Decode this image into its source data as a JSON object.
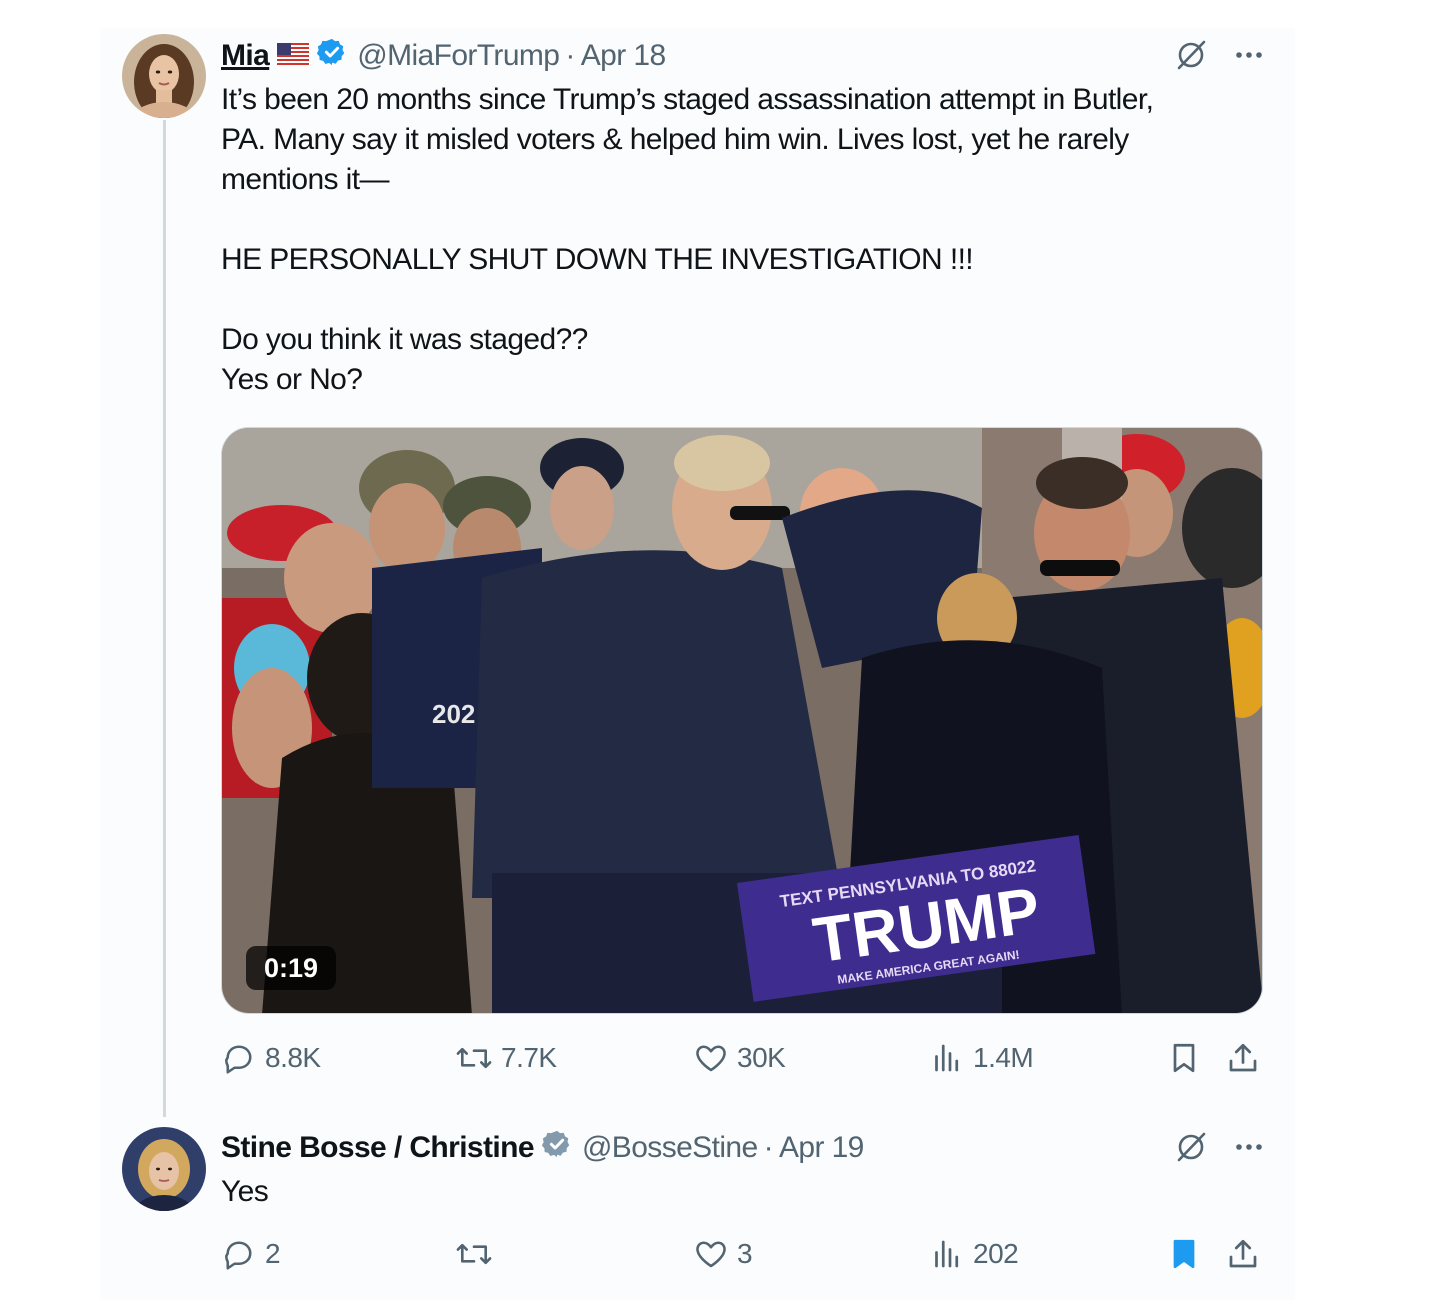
{
  "tweet": {
    "author_name": "Mia",
    "author_handle": "@MiaForTrump",
    "separator": "·",
    "date": "Apr 18",
    "text_lines": [
      "It’s been 20 months since Trump’s staged assassination attempt in Butler,",
      "PA. Many say it misled voters & helped him win. Lives lost, yet he rarely",
      "mentions it—",
      "",
      "HE PERSONALLY SHUT DOWN THE INVESTIGATION !!!",
      "",
      "Do you think it was staged??",
      "Yes or No?"
    ],
    "video": {
      "duration": "0:19",
      "sign_top": "TEXT PENNSYLVANIA TO 88022",
      "sign_main": "TRUMP",
      "sign_bottom": "MAKE AMERICA GREAT AGAIN!",
      "shirt_text": "202"
    },
    "stats": {
      "replies": "8.8K",
      "reposts": "7.7K",
      "likes": "30K",
      "views": "1.4M"
    }
  },
  "reply": {
    "author_name": "Stine Bosse / Christine",
    "author_handle": "@BosseStine",
    "separator": "·",
    "date": "Apr 19",
    "text": "Yes",
    "stats": {
      "replies": "2",
      "reposts": "",
      "likes": "3",
      "views": "202"
    },
    "bookmarked": true
  },
  "colors": {
    "accent": "#1d9bf0",
    "verified_blue": "#1d9bf0",
    "verified_gray": "#829aab",
    "muted": "#536471",
    "text": "#0f1419",
    "thread_line": "#cfd9de"
  },
  "icons": [
    "grok-icon",
    "more-icon",
    "reply-icon",
    "repost-icon",
    "like-icon",
    "views-icon",
    "bookmark-icon",
    "share-icon",
    "verified-icon",
    "us-flag-icon"
  ]
}
